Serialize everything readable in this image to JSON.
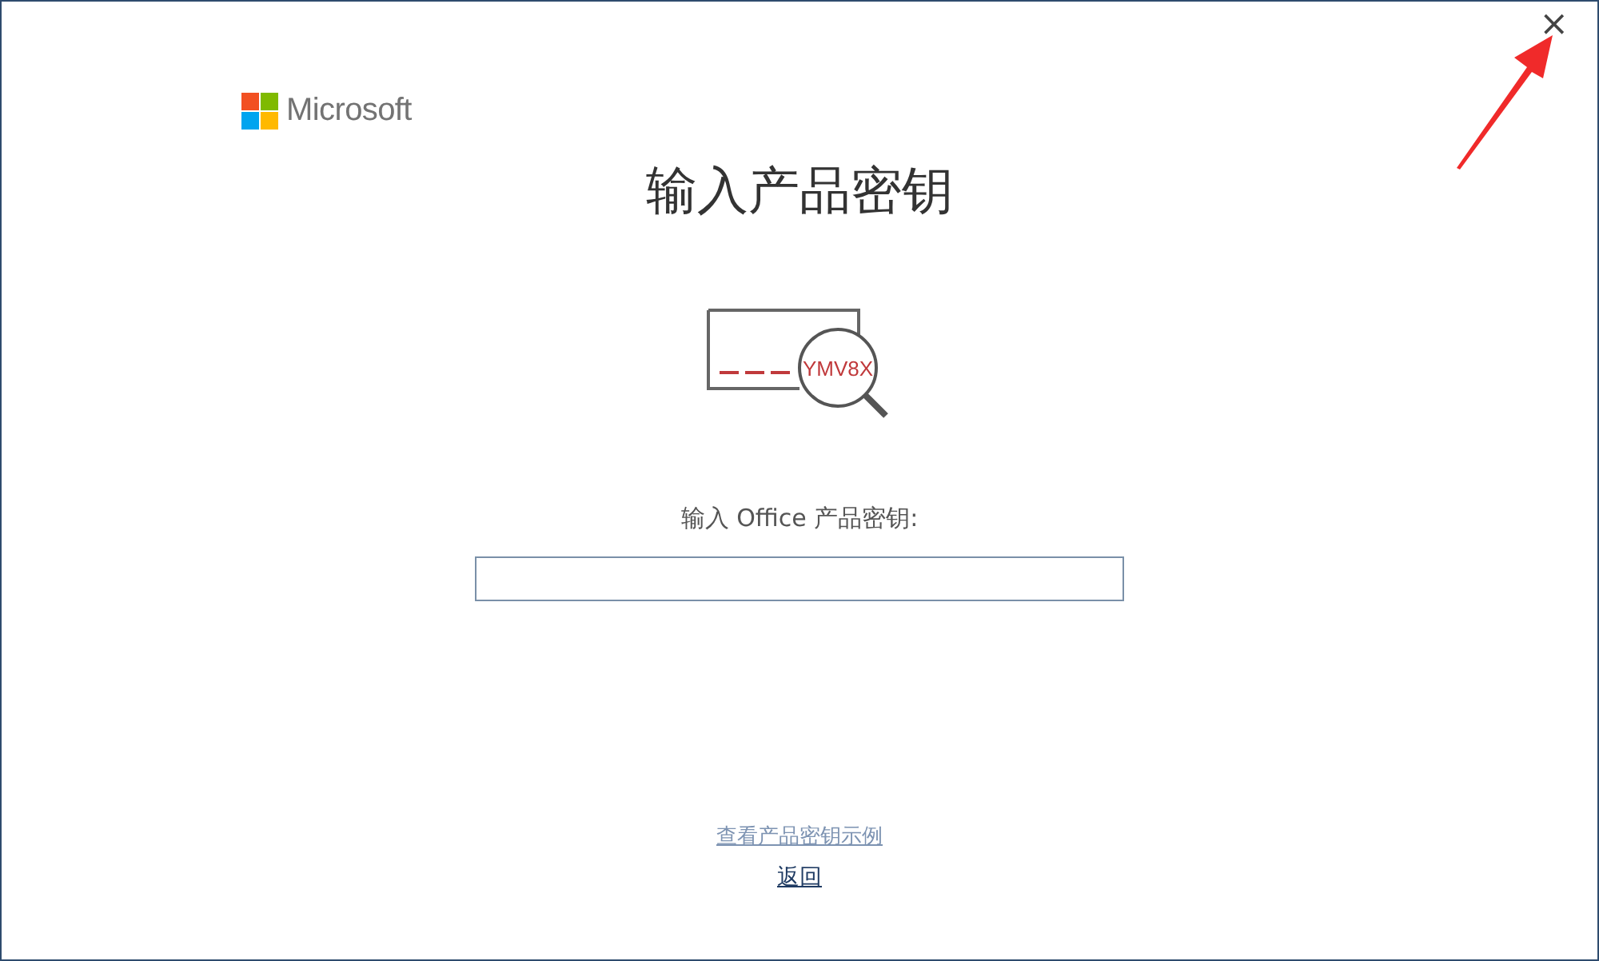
{
  "window": {
    "close": "×"
  },
  "logo": {
    "text": "Microsoft"
  },
  "title": "输入产品密钥",
  "illustration": {
    "key_text": "YMV8X"
  },
  "key_field": {
    "label": "输入 Office 产品密钥:"
  },
  "links": [
    {
      "text": "查看产品密钥示例",
      "kind": "secondary"
    },
    {
      "text": "返回",
      "kind": "primary"
    }
  ]
}
